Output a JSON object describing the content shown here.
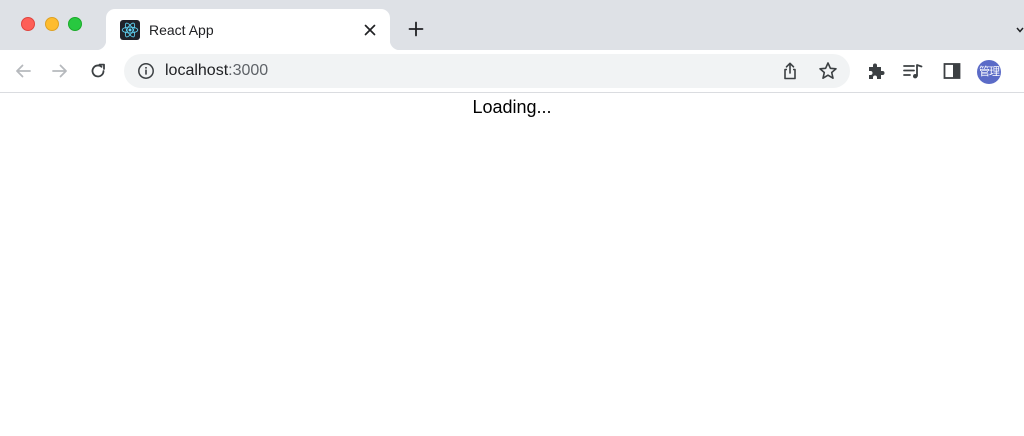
{
  "browser": {
    "tab": {
      "title": "React App",
      "favicon": "react-logo-icon"
    },
    "address_bar": {
      "host": "localhost",
      "port": ":3000",
      "leading_icon": "info-icon"
    },
    "toolbar_icons": [
      "back-arrow-icon",
      "forward-arrow-icon",
      "reload-icon",
      "share-icon",
      "star-icon",
      "extensions-puzzle-icon",
      "media-queue-icon",
      "side-panel-icon"
    ],
    "profile": {
      "label": "管理",
      "color": "#5b6bc7"
    }
  },
  "page": {
    "message": "Loading..."
  },
  "colors": {
    "tabstrip": "#dee1e6",
    "omnibox": "#f1f3f4",
    "react_cyan": "#61dafb",
    "traffic_red": "#fe5f57",
    "traffic_yellow": "#febc2e",
    "traffic_green": "#28c840"
  }
}
